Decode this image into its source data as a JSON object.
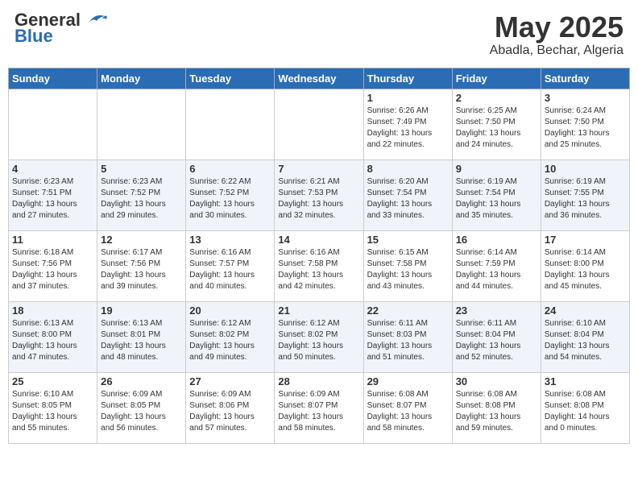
{
  "header": {
    "logo_general": "General",
    "logo_blue": "Blue",
    "month": "May 2025",
    "location": "Abadla, Bechar, Algeria"
  },
  "weekdays": [
    "Sunday",
    "Monday",
    "Tuesday",
    "Wednesday",
    "Thursday",
    "Friday",
    "Saturday"
  ],
  "rows": [
    [
      {
        "day": "",
        "info": ""
      },
      {
        "day": "",
        "info": ""
      },
      {
        "day": "",
        "info": ""
      },
      {
        "day": "",
        "info": ""
      },
      {
        "day": "1",
        "info": "Sunrise: 6:26 AM\nSunset: 7:49 PM\nDaylight: 13 hours\nand 22 minutes."
      },
      {
        "day": "2",
        "info": "Sunrise: 6:25 AM\nSunset: 7:50 PM\nDaylight: 13 hours\nand 24 minutes."
      },
      {
        "day": "3",
        "info": "Sunrise: 6:24 AM\nSunset: 7:50 PM\nDaylight: 13 hours\nand 25 minutes."
      }
    ],
    [
      {
        "day": "4",
        "info": "Sunrise: 6:23 AM\nSunset: 7:51 PM\nDaylight: 13 hours\nand 27 minutes."
      },
      {
        "day": "5",
        "info": "Sunrise: 6:23 AM\nSunset: 7:52 PM\nDaylight: 13 hours\nand 29 minutes."
      },
      {
        "day": "6",
        "info": "Sunrise: 6:22 AM\nSunset: 7:52 PM\nDaylight: 13 hours\nand 30 minutes."
      },
      {
        "day": "7",
        "info": "Sunrise: 6:21 AM\nSunset: 7:53 PM\nDaylight: 13 hours\nand 32 minutes."
      },
      {
        "day": "8",
        "info": "Sunrise: 6:20 AM\nSunset: 7:54 PM\nDaylight: 13 hours\nand 33 minutes."
      },
      {
        "day": "9",
        "info": "Sunrise: 6:19 AM\nSunset: 7:54 PM\nDaylight: 13 hours\nand 35 minutes."
      },
      {
        "day": "10",
        "info": "Sunrise: 6:19 AM\nSunset: 7:55 PM\nDaylight: 13 hours\nand 36 minutes."
      }
    ],
    [
      {
        "day": "11",
        "info": "Sunrise: 6:18 AM\nSunset: 7:56 PM\nDaylight: 13 hours\nand 37 minutes."
      },
      {
        "day": "12",
        "info": "Sunrise: 6:17 AM\nSunset: 7:56 PM\nDaylight: 13 hours\nand 39 minutes."
      },
      {
        "day": "13",
        "info": "Sunrise: 6:16 AM\nSunset: 7:57 PM\nDaylight: 13 hours\nand 40 minutes."
      },
      {
        "day": "14",
        "info": "Sunrise: 6:16 AM\nSunset: 7:58 PM\nDaylight: 13 hours\nand 42 minutes."
      },
      {
        "day": "15",
        "info": "Sunrise: 6:15 AM\nSunset: 7:58 PM\nDaylight: 13 hours\nand 43 minutes."
      },
      {
        "day": "16",
        "info": "Sunrise: 6:14 AM\nSunset: 7:59 PM\nDaylight: 13 hours\nand 44 minutes."
      },
      {
        "day": "17",
        "info": "Sunrise: 6:14 AM\nSunset: 8:00 PM\nDaylight: 13 hours\nand 45 minutes."
      }
    ],
    [
      {
        "day": "18",
        "info": "Sunrise: 6:13 AM\nSunset: 8:00 PM\nDaylight: 13 hours\nand 47 minutes."
      },
      {
        "day": "19",
        "info": "Sunrise: 6:13 AM\nSunset: 8:01 PM\nDaylight: 13 hours\nand 48 minutes."
      },
      {
        "day": "20",
        "info": "Sunrise: 6:12 AM\nSunset: 8:02 PM\nDaylight: 13 hours\nand 49 minutes."
      },
      {
        "day": "21",
        "info": "Sunrise: 6:12 AM\nSunset: 8:02 PM\nDaylight: 13 hours\nand 50 minutes."
      },
      {
        "day": "22",
        "info": "Sunrise: 6:11 AM\nSunset: 8:03 PM\nDaylight: 13 hours\nand 51 minutes."
      },
      {
        "day": "23",
        "info": "Sunrise: 6:11 AM\nSunset: 8:04 PM\nDaylight: 13 hours\nand 52 minutes."
      },
      {
        "day": "24",
        "info": "Sunrise: 6:10 AM\nSunset: 8:04 PM\nDaylight: 13 hours\nand 54 minutes."
      }
    ],
    [
      {
        "day": "25",
        "info": "Sunrise: 6:10 AM\nSunset: 8:05 PM\nDaylight: 13 hours\nand 55 minutes."
      },
      {
        "day": "26",
        "info": "Sunrise: 6:09 AM\nSunset: 8:05 PM\nDaylight: 13 hours\nand 56 minutes."
      },
      {
        "day": "27",
        "info": "Sunrise: 6:09 AM\nSunset: 8:06 PM\nDaylight: 13 hours\nand 57 minutes."
      },
      {
        "day": "28",
        "info": "Sunrise: 6:09 AM\nSunset: 8:07 PM\nDaylight: 13 hours\nand 58 minutes."
      },
      {
        "day": "29",
        "info": "Sunrise: 6:08 AM\nSunset: 8:07 PM\nDaylight: 13 hours\nand 58 minutes."
      },
      {
        "day": "30",
        "info": "Sunrise: 6:08 AM\nSunset: 8:08 PM\nDaylight: 13 hours\nand 59 minutes."
      },
      {
        "day": "31",
        "info": "Sunrise: 6:08 AM\nSunset: 8:08 PM\nDaylight: 14 hours\nand 0 minutes."
      }
    ]
  ]
}
